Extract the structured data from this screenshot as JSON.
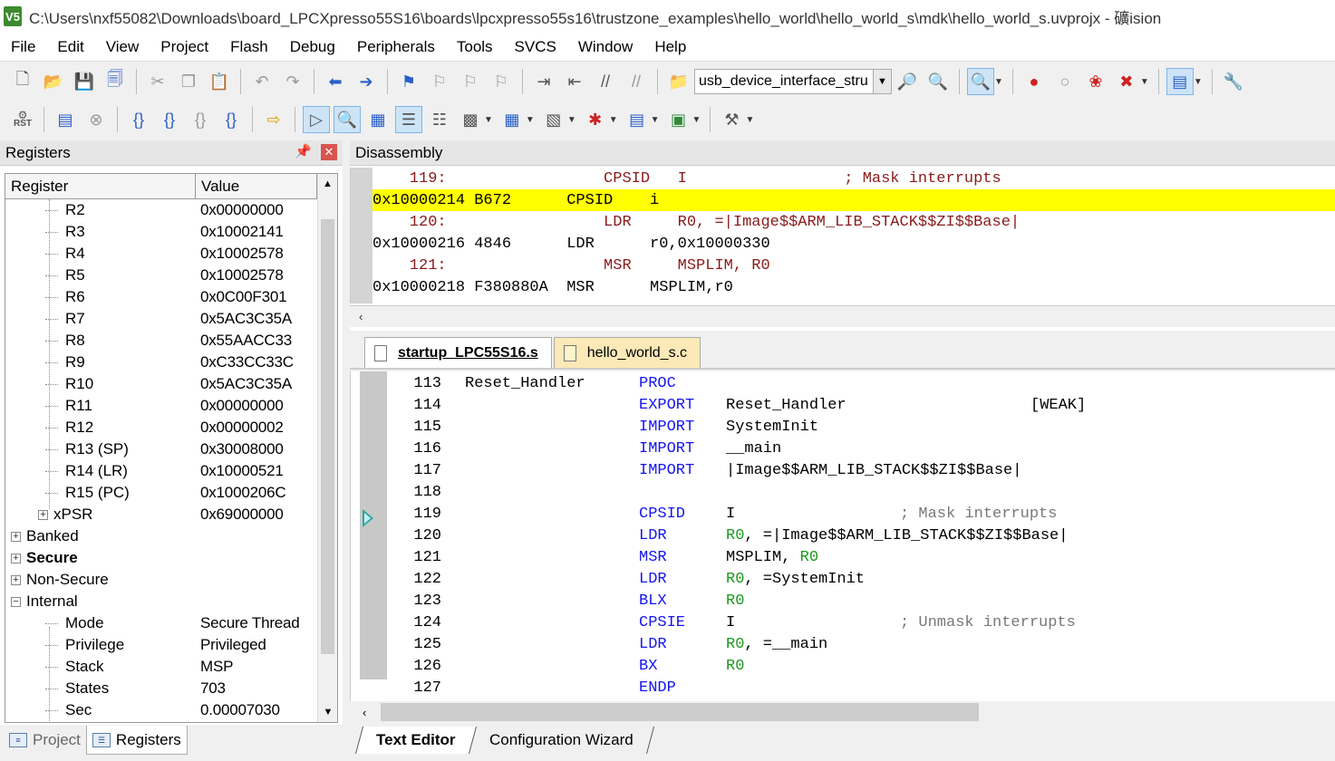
{
  "window": {
    "title": "C:\\Users\\nxf55082\\Downloads\\board_LPCXpresso55S16\\boards\\lpcxpresso55s16\\trustzone_examples\\hello_world\\hello_world_s\\mdk\\hello_world_s.uvprojx - 礦ision",
    "app_icon_text": "V5"
  },
  "menu": [
    "File",
    "Edit",
    "View",
    "Project",
    "Flash",
    "Debug",
    "Peripherals",
    "Tools",
    "SVCS",
    "Window",
    "Help"
  ],
  "toolbar": {
    "target": "usb_device_interface_stru",
    "rst_label": "RST"
  },
  "registers_panel": {
    "title": "Registers",
    "col_register": "Register",
    "col_value": "Value",
    "rows": [
      {
        "name": "R2",
        "value": "0x00000000"
      },
      {
        "name": "R3",
        "value": "0x10002141"
      },
      {
        "name": "R4",
        "value": "0x10002578"
      },
      {
        "name": "R5",
        "value": "0x10002578"
      },
      {
        "name": "R6",
        "value": "0x0C00F301"
      },
      {
        "name": "R7",
        "value": "0x5AC3C35A"
      },
      {
        "name": "R8",
        "value": "0x55AACC33"
      },
      {
        "name": "R9",
        "value": "0xC33CC33C"
      },
      {
        "name": "R10",
        "value": "0x5AC3C35A"
      },
      {
        "name": "R11",
        "value": "0x00000000"
      },
      {
        "name": "R12",
        "value": "0x00000002"
      },
      {
        "name": "R13 (SP)",
        "value": "0x30008000"
      },
      {
        "name": "R14 (LR)",
        "value": "0x10000521"
      },
      {
        "name": "R15 (PC)",
        "value": "0x1000206C"
      },
      {
        "name": "xPSR",
        "value": "0x69000000"
      }
    ],
    "groups": [
      {
        "name": "Banked",
        "expander": "+"
      },
      {
        "name": "Secure",
        "expander": "+"
      },
      {
        "name": "Non-Secure",
        "expander": "+"
      },
      {
        "name": "Internal",
        "expander": "−"
      }
    ],
    "internal_rows": [
      {
        "name": "Mode",
        "value": "Secure Thread"
      },
      {
        "name": "Privilege",
        "value": "Privileged"
      },
      {
        "name": "Stack",
        "value": "MSP"
      },
      {
        "name": "States",
        "value": "703"
      },
      {
        "name": "Sec",
        "value": "0.00007030"
      }
    ]
  },
  "left_tabs": {
    "project": "Project",
    "registers": "Registers"
  },
  "disassembly": {
    "title": "Disassembly",
    "lines": [
      {
        "text": "    119:                 CPSID   I                 ; Mask interrupts",
        "kind": "src"
      },
      {
        "text": "0x10000214 B672      CPSID    i",
        "kind": "asm-hl"
      },
      {
        "text": "    120:                 LDR     R0, =|Image$$ARM_LIB_STACK$$ZI$$Base|",
        "kind": "src"
      },
      {
        "text": "0x10000216 4846      LDR      r0,0x10000330",
        "kind": "asm"
      },
      {
        "text": "    121:                 MSR     MSPLIM, R0",
        "kind": "src"
      },
      {
        "text": "0x10000218 F380880A  MSR      MSPLIM,r0",
        "kind": "asm"
      }
    ]
  },
  "editor_tabs": {
    "tab1": "startup_LPC55S16.s",
    "tab2": "hello_world_s.c"
  },
  "editor_lines": [
    {
      "num": "113",
      "label": "Reset_Handler",
      "kw": "PROC",
      "op": "",
      "reg": "",
      "op2": "",
      "comment": ""
    },
    {
      "num": "114",
      "label": "",
      "kw": "EXPORT",
      "op": "Reset_Handler",
      "reg": "",
      "op2": "",
      "comment": "[WEAK]"
    },
    {
      "num": "115",
      "label": "",
      "kw": "IMPORT",
      "op": "SystemInit",
      "reg": "",
      "op2": "",
      "comment": ""
    },
    {
      "num": "116",
      "label": "",
      "kw": "IMPORT",
      "op": "__main",
      "reg": "",
      "op2": "",
      "comment": ""
    },
    {
      "num": "117",
      "label": "",
      "kw": "IMPORT",
      "op": "|Image$$ARM_LIB_STACK$$ZI$$Base|",
      "reg": "",
      "op2": "",
      "comment": ""
    },
    {
      "num": "118",
      "label": "",
      "kw": "",
      "op": "",
      "reg": "",
      "op2": "",
      "comment": ""
    },
    {
      "num": "119",
      "label": "",
      "kw": "CPSID",
      "op": "I",
      "reg": "",
      "op2": "",
      "comment": "; Mask interrupts"
    },
    {
      "num": "120",
      "label": "",
      "kw": "LDR",
      "op": "",
      "reg": "R0",
      "op2": ", =|Image$$ARM_LIB_STACK$$ZI$$Base|",
      "comment": ""
    },
    {
      "num": "121",
      "label": "",
      "kw": "MSR",
      "op": "MSPLIM, ",
      "reg": "R0",
      "op2": "",
      "comment": ""
    },
    {
      "num": "122",
      "label": "",
      "kw": "LDR",
      "op": "",
      "reg": "R0",
      "op2": ", =SystemInit",
      "comment": ""
    },
    {
      "num": "123",
      "label": "",
      "kw": "BLX",
      "op": "",
      "reg": "R0",
      "op2": "",
      "comment": ""
    },
    {
      "num": "124",
      "label": "",
      "kw": "CPSIE",
      "op": "I",
      "reg": "",
      "op2": "",
      "comment": "; Unmask interrupts"
    },
    {
      "num": "125",
      "label": "",
      "kw": "LDR",
      "op": "",
      "reg": "R0",
      "op2": ", =__main",
      "comment": ""
    },
    {
      "num": "126",
      "label": "",
      "kw": "BX",
      "op": "",
      "reg": "R0",
      "op2": "",
      "comment": ""
    },
    {
      "num": "127",
      "label": "",
      "kw": "ENDP",
      "op": "",
      "reg": "",
      "op2": "",
      "comment": ""
    }
  ],
  "bottom_tabs": {
    "text_editor": "Text Editor",
    "config_wizard": "Configuration Wizard"
  }
}
